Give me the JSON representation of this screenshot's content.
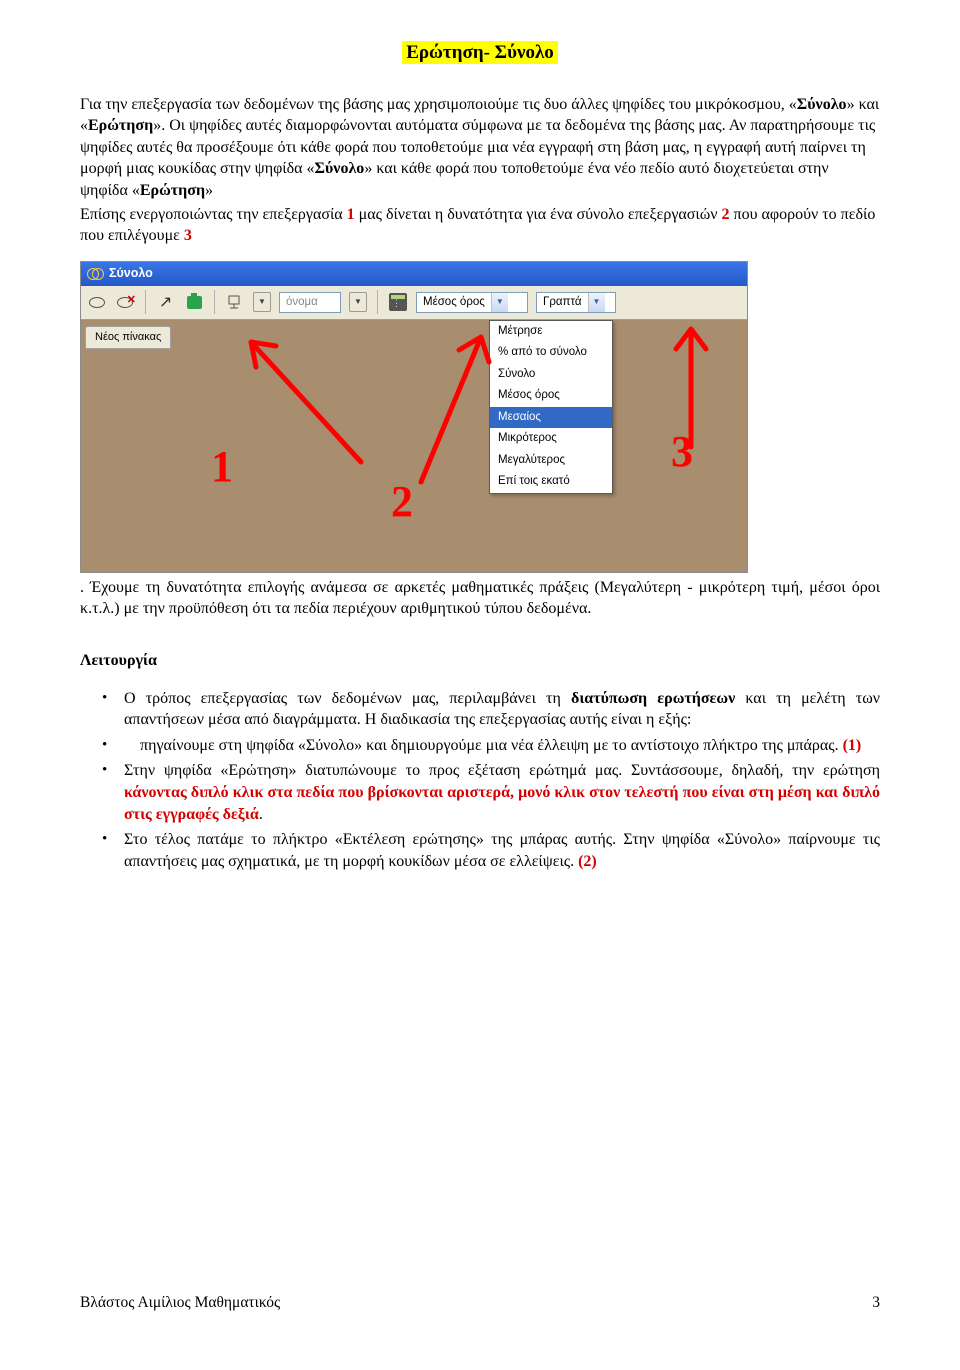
{
  "title": "Ερώτηση- Σύνολο",
  "para1": {
    "a": "Για την επεξεργασία των δεδομένων της βάσης μας χρησιμοποιούμε τις δυο άλλες ψηφίδες του μικρόκοσμου, «",
    "b": "Σύνολο",
    "c": "» και «",
    "d": "Ερώτηση",
    "e": "». Οι ψηφίδες αυτές διαμορφώνονται αυτόματα σύμφωνα με τα δεδομένα της βάσης μας. Αν παρατηρήσουμε τις ψηφίδες αυτές θα προσέξουμε ότι κάθε φορά που τοποθετούμε μια νέα εγγραφή στη βάση μας, η εγγραφή αυτή παίρνει τη μορφή μιας κουκίδας στην ψηφίδα «",
    "f": "Σύνολο",
    "g": "» και κάθε φορά που τοποθετούμε ένα νέο πεδίο αυτό διοχετεύεται στην ψηφίδα «",
    "h": "Ερώτηση",
    "i": "»"
  },
  "para2": {
    "a": "Επίσης ενεργοποιώντας την επεξεργασία ",
    "n1": "1",
    "b": " μας δίνεται η δυνατότητα για ένα σύνολο επεξεργασιών ",
    "n2": "2",
    "c": " που αφορούν το πεδίο που επιλέγουμε ",
    "n3": "3"
  },
  "shot": {
    "window_title": "Σύνολο",
    "field_placeholder": "όνομα",
    "combo_selected": "Μέσος όρος",
    "right_combo": "Γραπτά",
    "tab_label": "Νέος πίνακας",
    "menu": [
      "Μέτρησε",
      "% από το σύνολο",
      "Σύνολο",
      "Μέσος όρος",
      "Μεσαίος",
      "Μικρότερος",
      "Μεγαλύτερος",
      "Επί τοις εκατό"
    ],
    "selected_index": 4,
    "anno1": "1",
    "anno2": "2",
    "anno3": "3"
  },
  "para3": ". Έχουμε τη δυνατότητα επιλογής ανάμεσα σε αρκετές μαθηματικές πράξεις (Μεγαλύτερη - μικρότερη τιμή, μέσοι όροι κ.τ.λ.) με την προϋπόθεση ότι τα πεδία περιέχουν αριθμητικού τύπου δεδομένα.",
  "section_head": "Λειτουργία",
  "bul1": {
    "a": "Ο τρόπος επεξεργασίας των δεδομένων μας, περιλαμβάνει τη ",
    "b": "διατύπωση ερωτήσεων",
    "c": " και τη μελέτη των απαντήσεων μέσα από διαγράμματα. Η διαδικασία της επεξεργασίας αυτής είναι η εξής:"
  },
  "bul2": {
    "a": "πηγαίνουμε στη ψηφίδα «Σύνολο» και δημιουργούμε μια νέα έλλειψη με το αντίστοιχο πλήκτρο της μπάρας. ",
    "n": "(1)"
  },
  "bul3": {
    "a": "Στην ψηφίδα «Ερώτηση» διατυπώνουμε το προς εξέταση ερώτημά μας. Συντάσσουμε, δηλαδή, την ερώτηση ",
    "r": "κάνοντας διπλό κλικ στα πεδία που βρίσκονται αριστερά, μονό κλικ στον τελεστή που είναι στη μέση και διπλό στις εγγραφές δεξιά",
    "c": "."
  },
  "bul4": {
    "a": "Στο τέλος πατάμε το πλήκτρο «Εκτέλεση ερώτησης» της μπάρας αυτής. Στην ψηφίδα «Σύνολο» παίρνουμε τις απαντήσεις μας σχηματικά, με τη μορφή κουκίδων μέσα σε ελλείψεις. ",
    "n": "(2)"
  },
  "footer_left": "Βλάστος Αιμίλιος Μαθηματικός",
  "footer_right": "3"
}
